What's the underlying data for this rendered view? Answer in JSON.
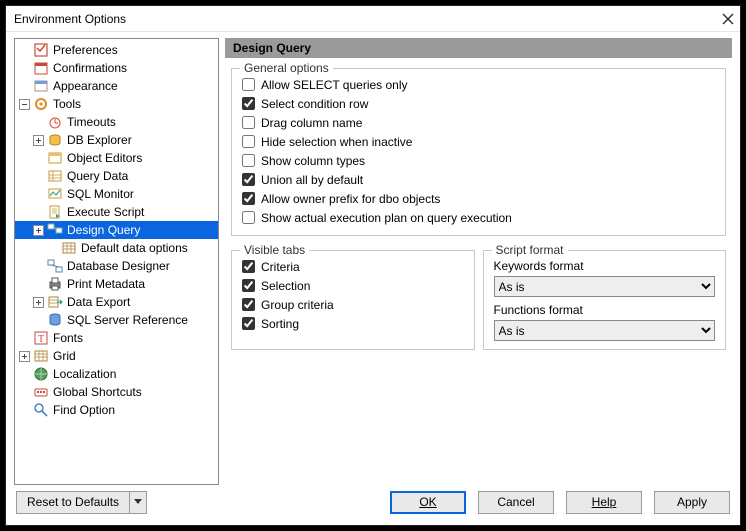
{
  "window": {
    "title": "Environment Options"
  },
  "tree": {
    "preferences": "Preferences",
    "confirmations": "Confirmations",
    "appearance": "Appearance",
    "tools": "Tools",
    "timeouts": "Timeouts",
    "db_explorer": "DB Explorer",
    "object_editors": "Object Editors",
    "query_data": "Query Data",
    "sql_monitor": "SQL Monitor",
    "execute_script": "Execute Script",
    "design_query": "Design Query",
    "default_data_options": "Default data options",
    "database_designer": "Database Designer",
    "print_metadata": "Print Metadata",
    "data_export": "Data Export",
    "sql_server_reference": "SQL Server Reference",
    "fonts": "Fonts",
    "grid": "Grid",
    "localization": "Localization",
    "global_shortcuts": "Global Shortcuts",
    "find_option": "Find Option"
  },
  "header": {
    "title": "Design Query"
  },
  "general": {
    "legend": "General options",
    "allow_select_only": {
      "label": "Allow SELECT queries only",
      "checked": false
    },
    "select_condition_row": {
      "label": "Select condition row",
      "checked": true
    },
    "drag_column_name": {
      "label": "Drag column name",
      "checked": false
    },
    "hide_selection_inactive": {
      "label": "Hide selection when inactive",
      "checked": false
    },
    "show_column_types": {
      "label": "Show column types",
      "checked": false
    },
    "union_all_default": {
      "label": "Union all by default",
      "checked": true
    },
    "allow_owner_prefix": {
      "label": "Allow owner prefix for dbo objects",
      "checked": true
    },
    "show_exec_plan": {
      "label": "Show actual execution plan on query execution",
      "checked": false
    }
  },
  "visible_tabs": {
    "legend": "Visible tabs",
    "criteria": {
      "label": "Criteria",
      "checked": true
    },
    "selection": {
      "label": "Selection",
      "checked": true
    },
    "group_criteria": {
      "label": "Group criteria",
      "checked": true
    },
    "sorting": {
      "label": "Sorting",
      "checked": true
    }
  },
  "script_format": {
    "legend": "Script format",
    "keywords_label": "Keywords format",
    "keywords_value": "As is",
    "functions_label": "Functions format",
    "functions_value": "As is"
  },
  "buttons": {
    "reset": "Reset to Defaults",
    "ok": "OK",
    "cancel": "Cancel",
    "help": "Help",
    "apply": "Apply"
  }
}
